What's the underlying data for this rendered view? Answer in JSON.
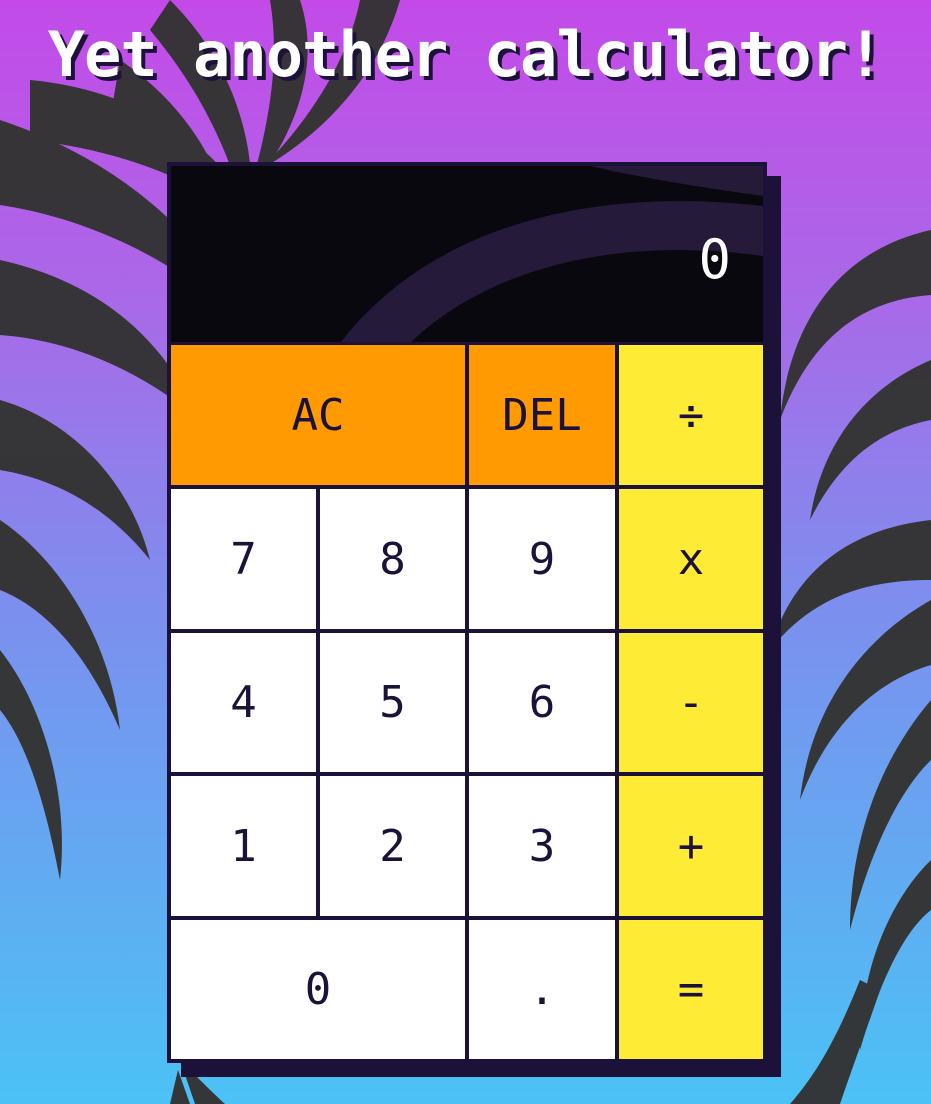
{
  "page": {
    "title": "Yet another calculator!"
  },
  "calculator": {
    "display": "0",
    "keys": {
      "ac": "AC",
      "del": "DEL",
      "divide": "÷",
      "seven": "7",
      "eight": "8",
      "nine": "9",
      "multiply": "x",
      "four": "4",
      "five": "5",
      "six": "6",
      "subtract": "-",
      "one": "1",
      "two": "2",
      "three": "3",
      "add": "+",
      "zero": "0",
      "decimal": ".",
      "equals": "="
    }
  },
  "colors": {
    "gradient_top": "#c44ae8",
    "gradient_bottom": "#4bc2f5",
    "frame": "#1b1139",
    "display_bg": "#0c0c10",
    "function_key": "#ff9a02",
    "number_key": "#ffffff",
    "operator_key": "#fdeb36",
    "palm_silhouette": "#333333"
  }
}
